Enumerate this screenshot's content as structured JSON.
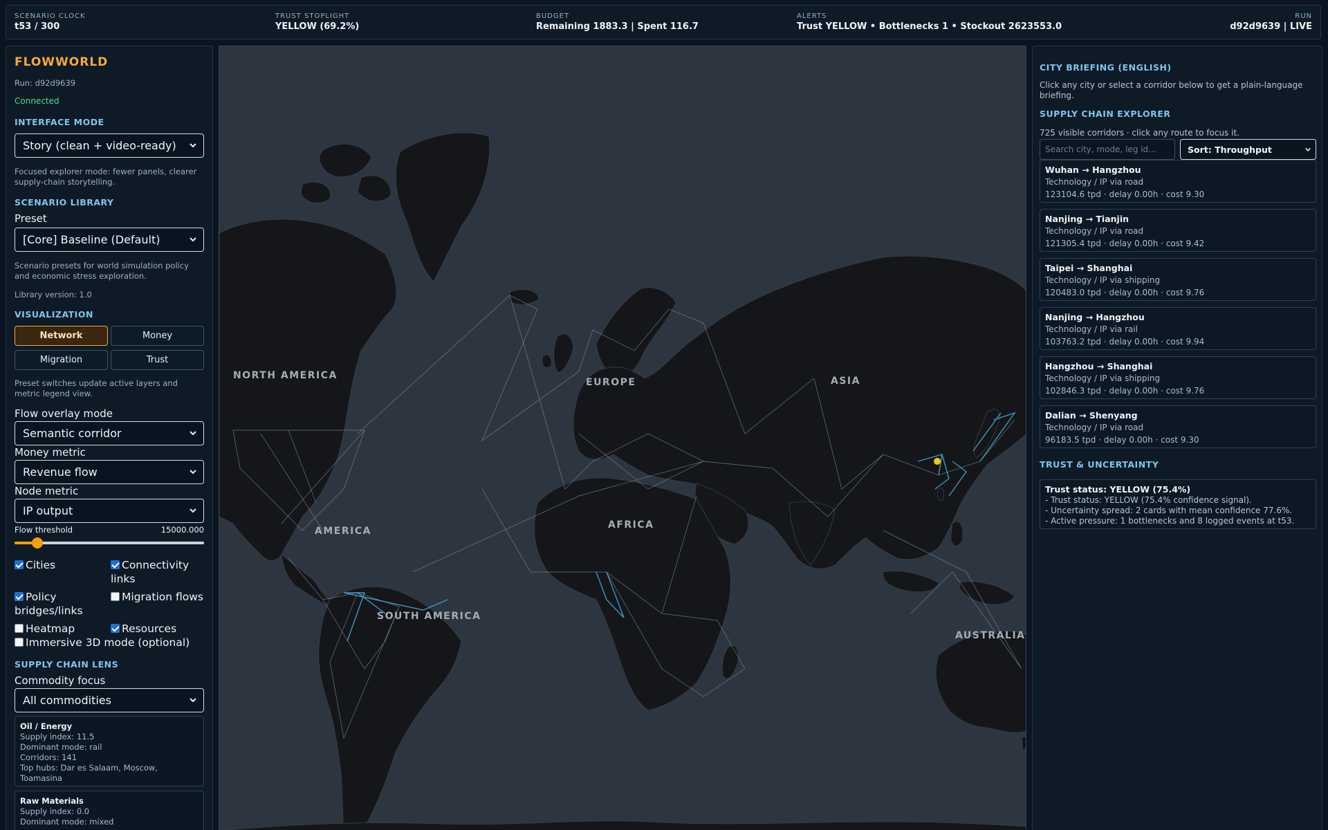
{
  "topbar": {
    "clock_label": "SCENARIO CLOCK",
    "clock_value": "t53 / 300",
    "trust_label": "TRUST STOPLIGHT",
    "trust_value": "YELLOW (69.2%)",
    "budget_label": "BUDGET",
    "budget_value": "Remaining 1883.3 | Spent 116.7",
    "alerts_label": "ALERTS",
    "alerts_value": "Trust YELLOW • Bottlenecks 1 • Stockout 2623553.0",
    "run_label": "RUN",
    "run_value": "d92d9639 | LIVE"
  },
  "sidebar": {
    "brand": "FLOWWORLD",
    "run": "Run: d92d9639",
    "status": "Connected",
    "interface_mode_title": "INTERFACE MODE",
    "interface_mode_value": "Story (clean + video-ready)",
    "interface_mode_help": "Focused explorer mode: fewer panels, clearer supply-chain storytelling.",
    "scenario_title": "SCENARIO LIBRARY",
    "preset_label": "Preset",
    "preset_value": "[Core] Baseline (Default)",
    "preset_help": "Scenario presets for world simulation policy and economic stress exploration.",
    "library_version": "Library version: 1.0",
    "viz_title": "VISUALIZATION",
    "viz_buttons": [
      "Network",
      "Money",
      "Migration",
      "Trust"
    ],
    "viz_help": "Preset switches update active layers and metric legend view.",
    "flow_overlay_label": "Flow overlay mode",
    "flow_overlay_value": "Semantic corridor",
    "money_metric_label": "Money metric",
    "money_metric_value": "Revenue flow",
    "node_metric_label": "Node metric",
    "node_metric_value": "IP output",
    "threshold_label": "Flow threshold",
    "threshold_value": "15000.000",
    "threshold_fraction": 0.12,
    "layers": [
      {
        "label": "Cities",
        "checked": true
      },
      {
        "label": "Connectivity links",
        "checked": true
      },
      {
        "label": "Policy bridges/links",
        "checked": true
      },
      {
        "label": "Migration flows",
        "checked": false
      },
      {
        "label": "Heatmap",
        "checked": false
      },
      {
        "label": "Resources",
        "checked": true
      },
      {
        "label": "Immersive 3D mode (optional)",
        "checked": false
      }
    ],
    "lens_title": "SUPPLY CHAIN LENS",
    "commodity_label": "Commodity focus",
    "commodity_value": "All commodities",
    "commodity_cards": [
      {
        "title": "Oil / Energy",
        "lines": [
          "Supply index: 11.5",
          "Dominant mode: rail",
          "Corridors: 141",
          "Top hubs: Dar es Salaam, Moscow, Toamasina"
        ]
      },
      {
        "title": "Raw Materials",
        "lines": [
          "Supply index: 0.0",
          "Dominant mode: mixed"
        ]
      }
    ]
  },
  "map": {
    "labels": [
      "NORTH AMERICA",
      "EUROPE",
      "ASIA",
      "AMERICA",
      "AFRICA",
      "SOUTH AMERICA",
      "AUSTRALIA"
    ]
  },
  "right": {
    "briefing_title": "CITY BRIEFING (ENGLISH)",
    "briefing_text": "Click any city or select a corridor below to get a plain-language briefing.",
    "explorer_title": "SUPPLY CHAIN EXPLORER",
    "explorer_count": "725 visible corridors · click any route to focus it.",
    "search_placeholder": "Search city, mode, leg id...",
    "sort_value": "Sort: Throughput",
    "routes": [
      {
        "title": "Wuhan → Hangzhou",
        "sub": "Technology / IP via road",
        "stats": "123104.6 tpd · delay 0.00h · cost 9.30"
      },
      {
        "title": "Nanjing → Tianjin",
        "sub": "Technology / IP via road",
        "stats": "121305.4 tpd · delay 0.00h · cost 9.42"
      },
      {
        "title": "Taipei → Shanghai",
        "sub": "Technology / IP via shipping",
        "stats": "120483.0 tpd · delay 0.00h · cost 9.76"
      },
      {
        "title": "Nanjing → Hangzhou",
        "sub": "Technology / IP via rail",
        "stats": "103763.2 tpd · delay 0.00h · cost 9.94"
      },
      {
        "title": "Hangzhou → Shanghai",
        "sub": "Technology / IP via shipping",
        "stats": "102846.3 tpd · delay 0.00h · cost 9.76"
      },
      {
        "title": "Dalian → Shenyang",
        "sub": "Technology / IP via road",
        "stats": "96183.5 tpd · delay 0.00h · cost 9.30"
      }
    ],
    "trust_title": "TRUST & UNCERTAINTY",
    "trust_status": "Trust status: YELLOW (75.4%)",
    "trust_lines": [
      "- Trust status: YELLOW (75.4% confidence signal).",
      "- Uncertainty spread: 2 cards with mean confidence 77.6%.",
      "- Active pressure: 1 bottlenecks and 8 logged events at t53."
    ]
  },
  "colors": {
    "accent": "#f5a93b",
    "link": "#7fc4ec",
    "ok": "#4ade80",
    "land": "#141619",
    "sea": "#2c3540",
    "route_hot": "#3fa7d6"
  }
}
